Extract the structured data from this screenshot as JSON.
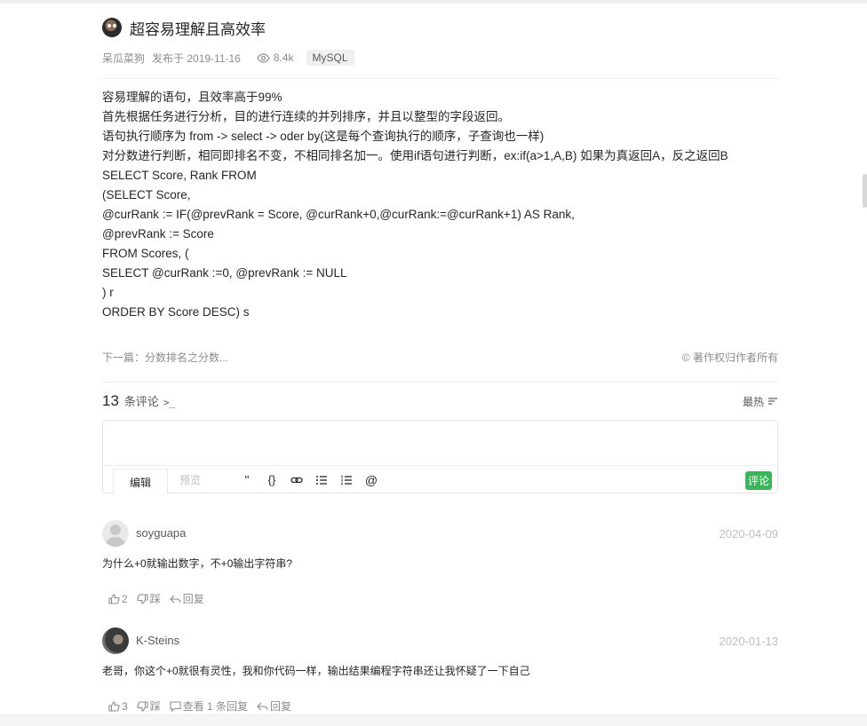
{
  "article": {
    "title": "超容易理解且高效率",
    "author": "呆瓜菜狗",
    "published": "发布于 2019-11-16",
    "views": "8.4k",
    "tag": "MySQL",
    "content_lines": [
      "容易理解的语句，且效率高于99%",
      "首先根据任务进行分析，目的进行连续的并列排序，并且以整型的字段返回。",
      "语句执行顺序为 from -> select -> oder by(这是每个查询执行的顺序，子查询也一样)",
      "对分数进行判断，相同即排名不变，不相同排名加一。使用if语句进行判断，ex:if(a>1,A,B) 如果为真返回A，反之返回B",
      "SELECT Score, Rank FROM",
      "(SELECT Score,",
      "@curRank := IF(@prevRank = Score, @curRank+0,@curRank:=@curRank+1) AS Rank,",
      "@prevRank := Score",
      "FROM Scores, (",
      "SELECT @curRank :=0, @prevRank := NULL",
      ") r",
      "ORDER BY Score DESC) s"
    ],
    "next": "下一篇：分数排名之分数...",
    "copyright": "© 著作权归作者所有"
  },
  "comments_header": {
    "count": "13",
    "label": "条评论",
    "caret": ">_",
    "sort_label": "最热"
  },
  "editor": {
    "tab_edit": "编辑",
    "tab_preview": "预览",
    "tools": [
      "''",
      "{}"
    ],
    "submit": "评论"
  },
  "comments": [
    {
      "user": "soyguapa",
      "date": "2020-04-09",
      "text": "为什么+0就输出数字，不+0输出字符串?",
      "likes": "2",
      "dislike": "踩",
      "reply": "回复"
    },
    {
      "user": "K-Steins",
      "date": "2020-01-13",
      "text": "老哥，你这个+0就很有灵性，我和你代码一样，输出结果编程字符串还让我怀疑了一下自己",
      "likes": "3",
      "dislike": "踩",
      "view_replies": "查看 1 条回复",
      "reply": "回复"
    }
  ],
  "colors": {
    "accent_green": "#3bb45b",
    "text": "#262626",
    "muted": "#8c8c8c"
  }
}
